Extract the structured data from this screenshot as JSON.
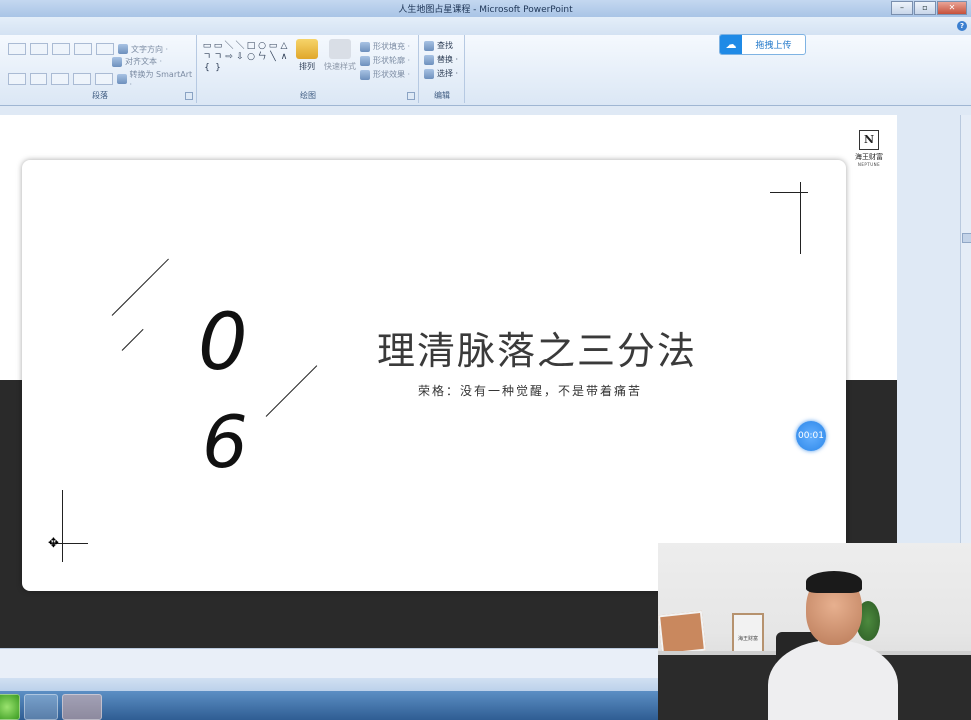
{
  "window": {
    "title": "人生地图占星课程 - Microsoft PowerPoint",
    "min": "–",
    "max": "▫",
    "close": "✕"
  },
  "ribbon": {
    "groups": {
      "paragraph": "段落",
      "drawing": "绘图",
      "editing": "编辑"
    },
    "paragraph": {
      "text_direction": "文字方向 ·",
      "align_text": "对齐文本 ·",
      "smartart": "转换为 SmartArt ·"
    },
    "drawing": {
      "arrange": "排列",
      "quick_styles": "快速样式",
      "shape_fill": "形状填充 ·",
      "shape_outline": "形状轮廓 ·",
      "shape_effects": "形状效果 ·"
    },
    "editing": {
      "find": "查找",
      "replace": "替换 ·",
      "select": "选择 ·"
    },
    "shapes": [
      "▭",
      "▭",
      "＼",
      "＼",
      "□",
      "○",
      "▭",
      "△",
      "ㄱ",
      "ㄱ",
      "⇨",
      "⇩",
      "○",
      "ㄣ",
      "╲",
      "∧",
      "{",
      "}"
    ]
  },
  "upload_button": {
    "label": "拖拽上传"
  },
  "slide": {
    "logo_cn": "海王财富",
    "logo_en": "NEPTUNE",
    "logo_mark": "N",
    "number_top": "0",
    "number_bottom": "6",
    "heading": "理清脉落之三分法",
    "quote": "荣格：没有一种觉醒，不是带着痛苦"
  },
  "recording_timer": "00:01",
  "webcam": {
    "frame_label": "海王财富"
  },
  "colors": {
    "accent": "#2c86e8",
    "ribbon": "#dbe7f5",
    "taskbar": "#2f5d93"
  }
}
